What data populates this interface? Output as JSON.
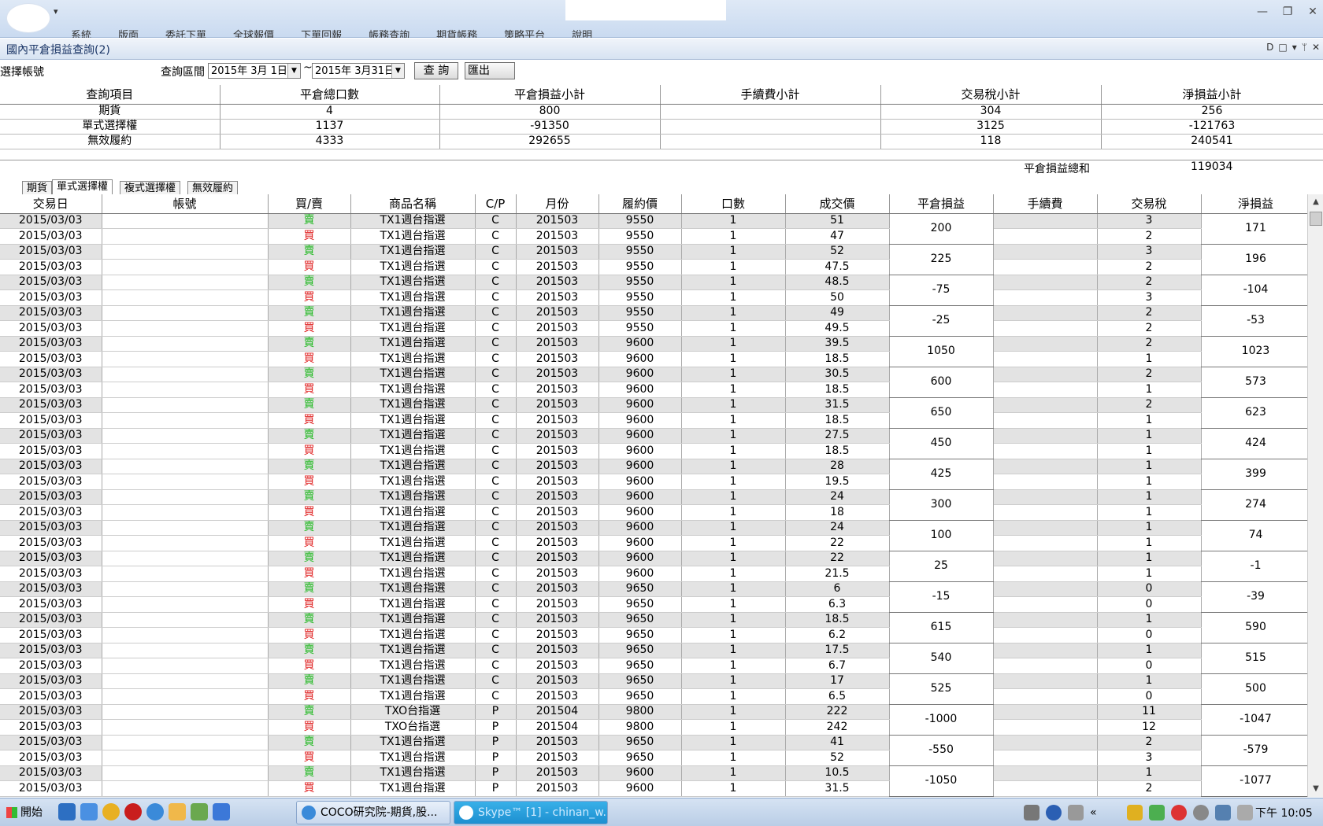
{
  "window": {
    "ribbon_items": [
      "系統",
      "版面",
      "委託下單",
      "全球報價",
      "下單回報",
      "帳務查詢",
      "期貨帳務",
      "策略平台",
      "說明"
    ],
    "minimize_glyph": "—",
    "restore_glyph": "❐",
    "close_glyph": "✕"
  },
  "subwindow": {
    "title": "國內平倉損益查詢(2)",
    "icons": [
      "D",
      "□",
      "▾",
      "ᛘ",
      "✕"
    ]
  },
  "filter": {
    "account_label": "選擇帳號",
    "range_label": "查詢區間",
    "date_from": "2015年 3月 1日",
    "tilde": "~",
    "date_to": "2015年 3月31日",
    "query_button": "查 詢",
    "export_button": "匯出Excel"
  },
  "summary": {
    "headers": [
      "查詢項目",
      "平倉總口數",
      "平倉損益小計",
      "手續費小計",
      "交易稅小計",
      "淨損益小計"
    ],
    "rows": [
      [
        "期貨",
        "4",
        "800",
        "",
        "304",
        "256"
      ],
      [
        "單式選擇權",
        "1137",
        "-91350",
        "",
        "3125",
        "-121763"
      ],
      [
        "無效履約",
        "4333",
        "292655",
        "",
        "118",
        "240541"
      ]
    ],
    "total_label": "平倉損益總和",
    "total_value": "119034"
  },
  "tabs": [
    "期貨",
    "單式選擇權",
    "複式選擇權",
    "無效履約"
  ],
  "active_tab": 1,
  "grid": {
    "headers": [
      "交易日",
      "帳號",
      "買/賣",
      "商品名稱",
      "C/P",
      "月份",
      "履約價",
      "口數",
      "成交價",
      "平倉損益",
      "手續費",
      "交易稅",
      "淨損益"
    ],
    "rows": [
      [
        "2015/03/03",
        "",
        "賣",
        "TX1週台指選",
        "C",
        "201503",
        "9550",
        "1",
        "51",
        "3"
      ],
      [
        "2015/03/03",
        "",
        "買",
        "TX1週台指選",
        "C",
        "201503",
        "9550",
        "1",
        "47",
        "2"
      ],
      [
        "2015/03/03",
        "",
        "賣",
        "TX1週台指選",
        "C",
        "201503",
        "9550",
        "1",
        "52",
        "3"
      ],
      [
        "2015/03/03",
        "",
        "買",
        "TX1週台指選",
        "C",
        "201503",
        "9550",
        "1",
        "47.5",
        "2"
      ],
      [
        "2015/03/03",
        "",
        "賣",
        "TX1週台指選",
        "C",
        "201503",
        "9550",
        "1",
        "48.5",
        "2"
      ],
      [
        "2015/03/03",
        "",
        "買",
        "TX1週台指選",
        "C",
        "201503",
        "9550",
        "1",
        "50",
        "3"
      ],
      [
        "2015/03/03",
        "",
        "賣",
        "TX1週台指選",
        "C",
        "201503",
        "9550",
        "1",
        "49",
        "2"
      ],
      [
        "2015/03/03",
        "",
        "買",
        "TX1週台指選",
        "C",
        "201503",
        "9550",
        "1",
        "49.5",
        "2"
      ],
      [
        "2015/03/03",
        "",
        "賣",
        "TX1週台指選",
        "C",
        "201503",
        "9600",
        "1",
        "39.5",
        "2"
      ],
      [
        "2015/03/03",
        "",
        "買",
        "TX1週台指選",
        "C",
        "201503",
        "9600",
        "1",
        "18.5",
        "1"
      ],
      [
        "2015/03/03",
        "",
        "賣",
        "TX1週台指選",
        "C",
        "201503",
        "9600",
        "1",
        "30.5",
        "2"
      ],
      [
        "2015/03/03",
        "",
        "買",
        "TX1週台指選",
        "C",
        "201503",
        "9600",
        "1",
        "18.5",
        "1"
      ],
      [
        "2015/03/03",
        "",
        "賣",
        "TX1週台指選",
        "C",
        "201503",
        "9600",
        "1",
        "31.5",
        "2"
      ],
      [
        "2015/03/03",
        "",
        "買",
        "TX1週台指選",
        "C",
        "201503",
        "9600",
        "1",
        "18.5",
        "1"
      ],
      [
        "2015/03/03",
        "",
        "賣",
        "TX1週台指選",
        "C",
        "201503",
        "9600",
        "1",
        "27.5",
        "1"
      ],
      [
        "2015/03/03",
        "",
        "買",
        "TX1週台指選",
        "C",
        "201503",
        "9600",
        "1",
        "18.5",
        "1"
      ],
      [
        "2015/03/03",
        "",
        "賣",
        "TX1週台指選",
        "C",
        "201503",
        "9600",
        "1",
        "28",
        "1"
      ],
      [
        "2015/03/03",
        "",
        "買",
        "TX1週台指選",
        "C",
        "201503",
        "9600",
        "1",
        "19.5",
        "1"
      ],
      [
        "2015/03/03",
        "",
        "賣",
        "TX1週台指選",
        "C",
        "201503",
        "9600",
        "1",
        "24",
        "1"
      ],
      [
        "2015/03/03",
        "",
        "買",
        "TX1週台指選",
        "C",
        "201503",
        "9600",
        "1",
        "18",
        "1"
      ],
      [
        "2015/03/03",
        "",
        "賣",
        "TX1週台指選",
        "C",
        "201503",
        "9600",
        "1",
        "24",
        "1"
      ],
      [
        "2015/03/03",
        "",
        "買",
        "TX1週台指選",
        "C",
        "201503",
        "9600",
        "1",
        "22",
        "1"
      ],
      [
        "2015/03/03",
        "",
        "賣",
        "TX1週台指選",
        "C",
        "201503",
        "9600",
        "1",
        "22",
        "1"
      ],
      [
        "2015/03/03",
        "",
        "買",
        "TX1週台指選",
        "C",
        "201503",
        "9600",
        "1",
        "21.5",
        "1"
      ],
      [
        "2015/03/03",
        "",
        "賣",
        "TX1週台指選",
        "C",
        "201503",
        "9650",
        "1",
        "6",
        "0"
      ],
      [
        "2015/03/03",
        "",
        "買",
        "TX1週台指選",
        "C",
        "201503",
        "9650",
        "1",
        "6.3",
        "0"
      ],
      [
        "2015/03/03",
        "",
        "賣",
        "TX1週台指選",
        "C",
        "201503",
        "9650",
        "1",
        "18.5",
        "1"
      ],
      [
        "2015/03/03",
        "",
        "買",
        "TX1週台指選",
        "C",
        "201503",
        "9650",
        "1",
        "6.2",
        "0"
      ],
      [
        "2015/03/03",
        "",
        "賣",
        "TX1週台指選",
        "C",
        "201503",
        "9650",
        "1",
        "17.5",
        "1"
      ],
      [
        "2015/03/03",
        "",
        "買",
        "TX1週台指選",
        "C",
        "201503",
        "9650",
        "1",
        "6.7",
        "0"
      ],
      [
        "2015/03/03",
        "",
        "賣",
        "TX1週台指選",
        "C",
        "201503",
        "9650",
        "1",
        "17",
        "1"
      ],
      [
        "2015/03/03",
        "",
        "買",
        "TX1週台指選",
        "C",
        "201503",
        "9650",
        "1",
        "6.5",
        "0"
      ],
      [
        "2015/03/03",
        "",
        "賣",
        "TXO台指選",
        "P",
        "201504",
        "9800",
        "1",
        "222",
        "11"
      ],
      [
        "2015/03/03",
        "",
        "買",
        "TXO台指選",
        "P",
        "201504",
        "9800",
        "1",
        "242",
        "12"
      ],
      [
        "2015/03/03",
        "",
        "賣",
        "TX1週台指選",
        "P",
        "201503",
        "9650",
        "1",
        "41",
        "2"
      ],
      [
        "2015/03/03",
        "",
        "買",
        "TX1週台指選",
        "P",
        "201503",
        "9650",
        "1",
        "52",
        "3"
      ],
      [
        "2015/03/03",
        "",
        "賣",
        "TX1週台指選",
        "P",
        "201503",
        "9600",
        "1",
        "10.5",
        "1"
      ],
      [
        "2015/03/03",
        "",
        "買",
        "TX1週台指選",
        "P",
        "201503",
        "9600",
        "1",
        "31.5",
        "2"
      ]
    ],
    "pair_pnl": [
      "200",
      "225",
      "-75",
      "-25",
      "1050",
      "600",
      "650",
      "450",
      "425",
      "300",
      "100",
      "25",
      "-15",
      "615",
      "540",
      "525",
      "-1000",
      "-550",
      "-1050"
    ],
    "pair_net": [
      "171",
      "196",
      "-104",
      "-53",
      "1023",
      "573",
      "623",
      "424",
      "399",
      "274",
      "74",
      "-1",
      "-39",
      "590",
      "515",
      "500",
      "-1047",
      "-579",
      "-1077"
    ]
  },
  "taskbar": {
    "start_label": "開始",
    "tasks": [
      "COCO研究院-期貨,股...",
      "Skype™ [1] - chinan_w..."
    ],
    "clock": "下午 10:05",
    "tray_chevron": "«"
  }
}
